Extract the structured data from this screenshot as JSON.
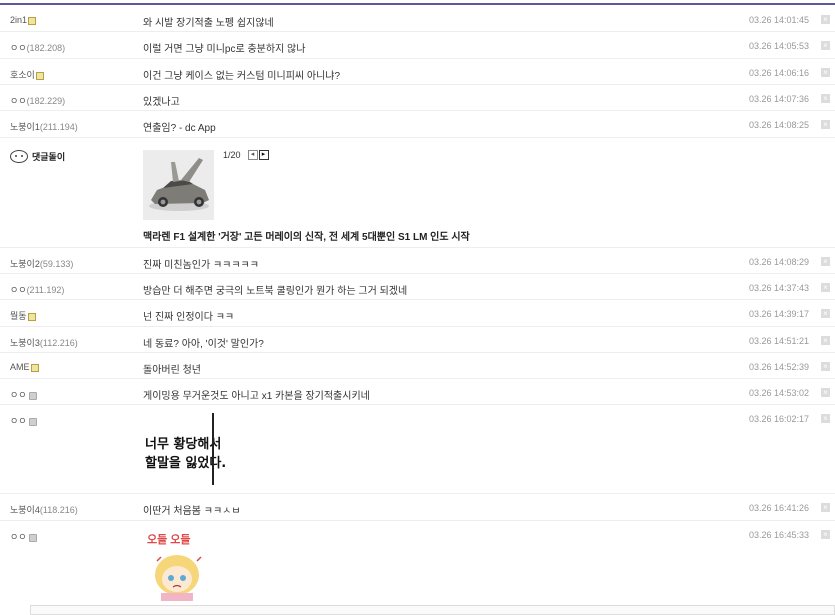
{
  "comments": [
    {
      "nick": "2in1",
      "ip": "",
      "text": "와 시발 장기적출 노펭 쉽지않네",
      "date": "03.26 14:01:45",
      "badge": "gallog"
    },
    {
      "nick": "ㅇㅇ",
      "ip": "(182.208)",
      "text": "이럴 거면 그냥 미니pc로 충분하지 않나",
      "date": "03.26 14:05:53",
      "badge": ""
    },
    {
      "nick": "호소이",
      "ip": "",
      "text": "이건 그냥 케이스 없는 커스텀 미니피씨 아니냐?",
      "date": "03.26 14:06:16",
      "badge": "gallog"
    },
    {
      "nick": "ㅇㅇ",
      "ip": "(182.229)",
      "text": "있겠나고",
      "date": "03.26 14:07:36",
      "badge": ""
    },
    {
      "nick": "노붕이1",
      "ip": "(211.194)",
      "text": "연출임? - dc App",
      "date": "03.26 14:08:25",
      "badge": ""
    }
  ],
  "bot": {
    "name": "댓글돌이",
    "pager": "1/20",
    "news_title": "맥라렌 F1 설계한 '거장' 고든 머레이의 신작, 전 세계 5대뿐인 S1 LM 인도 시작",
    "image_icon": "car-image"
  },
  "comments2": [
    {
      "nick": "노붕이2",
      "ip": "(59.133)",
      "text": "진짜 미친놈인가 ㅋㅋㅋㅋㅋ",
      "date": "03.26 14:08:29",
      "badge": ""
    },
    {
      "nick": "ㅇㅇ",
      "ip": "(211.192)",
      "text": "방습만 더 해주면 궁극의 노트북 쿨링인가 뭔가 하는 그거 되겠네",
      "date": "03.26 14:37:43",
      "badge": ""
    },
    {
      "nick": "뭘동",
      "ip": "",
      "text": "넌 진짜 인정이다 ㅋㅋ",
      "date": "03.26 14:39:17",
      "badge": "gallog"
    },
    {
      "nick": "노붕이3",
      "ip": "(112.216)",
      "text": "네 동료? 아아, '이것' 말인가?",
      "date": "03.26 14:51:21",
      "badge": ""
    },
    {
      "nick": "AME",
      "ip": "",
      "text": "돌아버린 청년",
      "date": "03.26 14:52:39",
      "badge": "gallog"
    },
    {
      "nick": "ㅇㅇ",
      "ip": "",
      "text": "게이밍용 무거운것도 아니고 x1 카본을 장기적출시키네",
      "date": "03.26 14:53:02",
      "badge": "anon"
    }
  ],
  "meme_comment": {
    "nick": "ㅇㅇ",
    "date": "03.26 16:02:17",
    "line1": "너무 황당해서",
    "line2": "할말을 잃었다."
  },
  "comments3": [
    {
      "nick": "노붕이4",
      "ip": "(118.216)",
      "text": "이딴거 처음봄 ㅋㅋㅅㅂ",
      "date": "03.26 16:41:26",
      "badge": ""
    }
  ],
  "sticker_comment": {
    "nick": "ㅇㅇ",
    "date": "03.26 16:45:33",
    "sticker_text": "오들 오들"
  },
  "delete_icon": "close-icon"
}
